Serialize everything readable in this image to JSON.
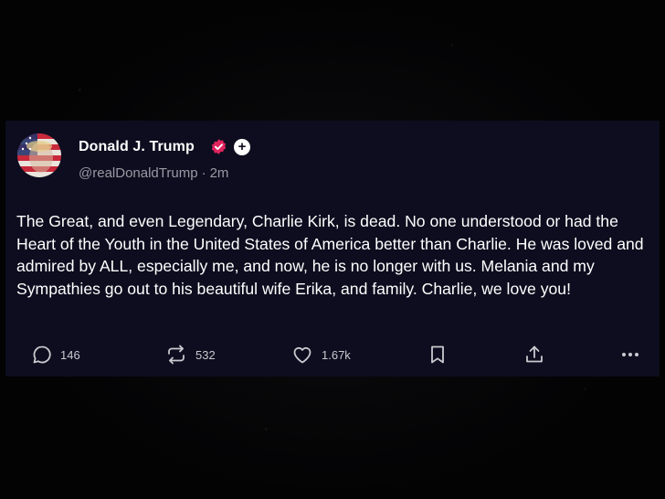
{
  "post": {
    "author_name": "Donald J. Trump",
    "handle": "@realDonaldTrump",
    "separator": "·",
    "time": "2m",
    "follow_label": "+",
    "text": "The Great, and even Legendary, Charlie Kirk, is dead. No one understood or had the Heart of the Youth in the United States of America better than Charlie. He was loved and admired by ALL, especially me, and now, he is no longer with us. Melania and my Sympathies go out to his beautiful wife Erika, and family. Charlie, we love you!",
    "actions": {
      "replies": "146",
      "reposts": "532",
      "likes": "1.67k"
    }
  },
  "colors": {
    "card_background": "#0d0d1f",
    "verified_badge": "#e0245e",
    "text": "#ffffff",
    "secondary_text": "#9a9aa3"
  },
  "icons": [
    "reply-icon",
    "repost-icon",
    "like-icon",
    "bookmark-icon",
    "share-icon",
    "more-icon",
    "verified-badge-icon"
  ]
}
